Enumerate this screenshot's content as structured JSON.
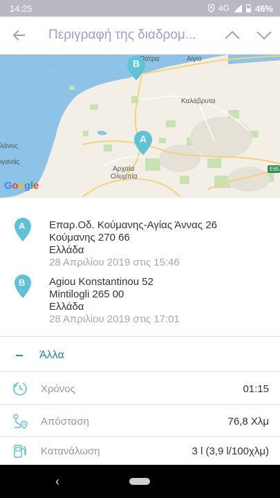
{
  "status_bar": {
    "time": "14:25",
    "network": "4G",
    "battery": "46%"
  },
  "app_bar": {
    "title": "Περιγραφή της διαδρομ..."
  },
  "map": {
    "labels": {
      "patra": "Πάτρα",
      "aigio": "Αίγιο",
      "kalavryta": "Καλάβρυτα",
      "archaia_olympia_1": "Αρχαία",
      "archaia_olympia_2": "Ολυμπία",
      "left1": "λάνος",
      "left2": "ιγανάς",
      "e65": "E65"
    },
    "logo": "Google",
    "marker_a": "A",
    "marker_b": "B"
  },
  "stops": [
    {
      "marker": "A",
      "line1": "Επαρ.Οδ. Κούμανης-Αγίας Άννας 26",
      "line2": "Κούμανης 270 66",
      "line3": "Ελλάδα",
      "time": "28 Απριλίου 2019 στις 15:46"
    },
    {
      "marker": "B",
      "line1": "Agiou Konstantinou 52",
      "line2": "Mintilogli 265 00",
      "line3": "Ελλάδα",
      "time": "28 Απριλίου 2019 στις 17:01"
    }
  ],
  "more": {
    "label": "Άλλα"
  },
  "metrics": [
    {
      "label": "Χρόνος",
      "value": "01:15",
      "icon": "clock-icon"
    },
    {
      "label": "Απόσταση",
      "value": "76,8 Χλμ",
      "icon": "route-icon"
    },
    {
      "label": "Κατανάλωση",
      "value": "3 l (3,9 l/100χλμ)",
      "icon": "fuel-icon"
    }
  ],
  "colors": {
    "accent": "#1f8a99",
    "marker": "#5ec3d6",
    "title": "#9e9ec8",
    "status_bar": "#b9b9c3"
  }
}
